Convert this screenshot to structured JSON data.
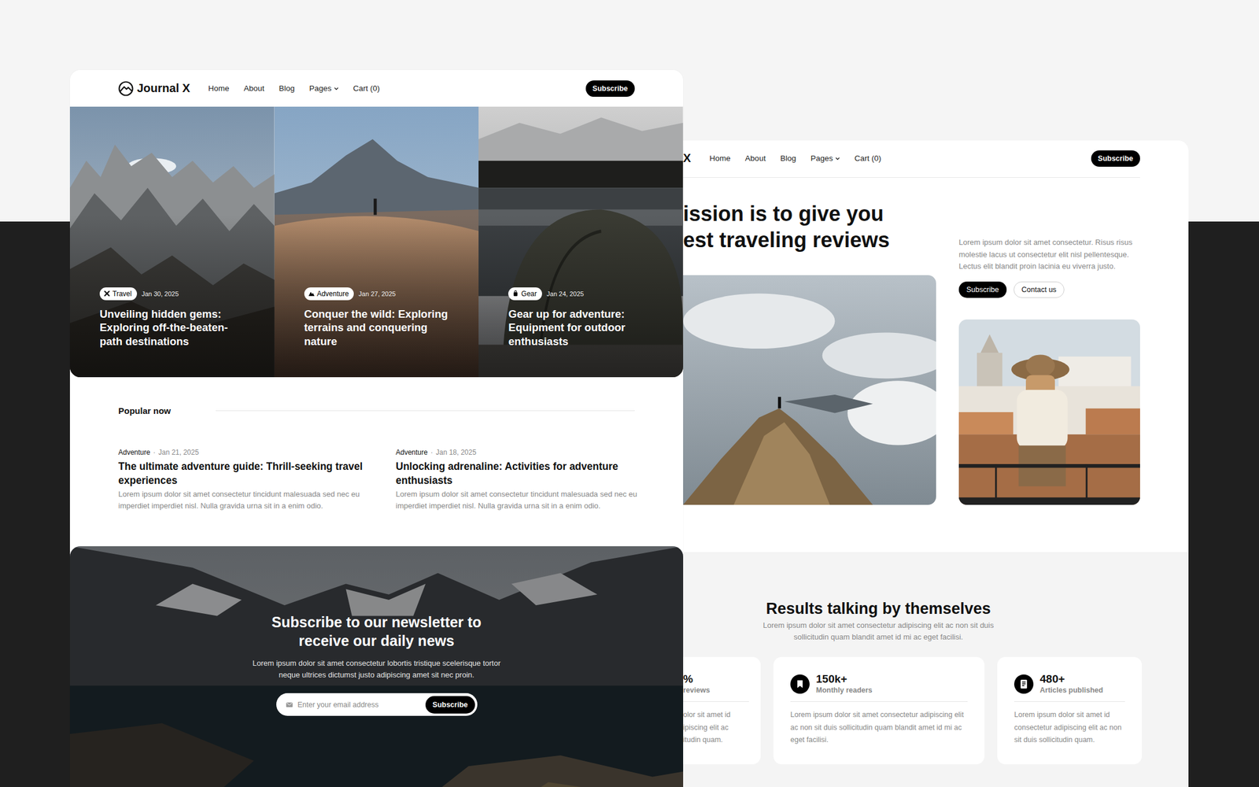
{
  "left_window": {
    "logo": "Journal X",
    "nav": [
      {
        "label": "Home",
        "has_dropdown": false
      },
      {
        "label": "About",
        "has_dropdown": false
      },
      {
        "label": "Blog",
        "has_dropdown": false
      },
      {
        "label": "Pages",
        "has_dropdown": true
      },
      {
        "label": "Cart (0)",
        "has_dropdown": false
      }
    ],
    "nav_button": "Subscribe",
    "hero_posts": [
      {
        "kind": "travel",
        "tag": "Travel",
        "date": "Jan 30, 2025",
        "title": "Unveiling hidden gems: Exploring off-the-beaten-path destinations"
      },
      {
        "kind": "adventure",
        "tag": "Adventure",
        "date": "Jan 27, 2025",
        "title": "Conquer the wild: Exploring terrains and conquering nature"
      },
      {
        "kind": "gear",
        "tag": "Gear",
        "date": "Jan 24, 2025",
        "title": "Gear up for adventure: Equipment for outdoor enthusiasts"
      }
    ],
    "popular": {
      "heading": "Popular now",
      "posts": [
        {
          "category": "Adventure",
          "separator": "·",
          "date": "Jan 21, 2025",
          "title": "The ultimate adventure guide: Thrill-seeking travel experiences",
          "excerpt": "Lorem ipsum dolor sit amet consectetur tincidunt malesuada sed nec eu imperdiet imperdiet nisl. Nulla gravida urna sit in a enim odio."
        },
        {
          "category": "Adventure",
          "separator": "·",
          "date": "Jan 18, 2025",
          "title": "Unlocking adrenaline: Activities for adventure enthusiasts",
          "excerpt": "Lorem ipsum dolor sit amet consectetur tincidunt malesuada sed nec eu imperdiet imperdiet nisl. Nulla gravida urna sit in a enim odio."
        }
      ]
    },
    "newsletter": {
      "heading": "Subscribe to our newsletter to receive our daily news",
      "text": "Lorem ipsum dolor sit amet consectetur lobortis tristique scelerisque tortor neque ultrices dictumst justo adipiscing amet sit nec proin.",
      "placeholder": "Enter your email address",
      "button": "Subscribe"
    }
  },
  "right_window": {
    "logo": "X",
    "nav": [
      {
        "label": "Home",
        "has_dropdown": false
      },
      {
        "label": "About",
        "has_dropdown": false
      },
      {
        "label": "Blog",
        "has_dropdown": false
      },
      {
        "label": "Pages",
        "has_dropdown": true
      },
      {
        "label": "Cart (0)",
        "has_dropdown": false
      }
    ],
    "nav_button": "Subscribe",
    "heading_lines": [
      "ission is to give you",
      "est traveling reviews"
    ],
    "intro": "Lorem ipsum dolor sit amet consectetur. Risus risus molestie lacus ut consectetur elit nisl pellentesque. Lectus elit blandit proin lacinia eu viverra justo.",
    "buttons": [
      {
        "label": "Subscribe",
        "kind": "dark"
      },
      {
        "label": "Contact us",
        "kind": "light"
      }
    ],
    "stats": {
      "heading": "Results talking by themselves",
      "text": "Lorem ipsum dolor sit amet consectetur adipiscing elit ac non sit duis sollicitudin quam blandit amet id mi ac eget facilisi.",
      "cards": [
        {
          "kind": "cut",
          "value": "%",
          "label": "reviews",
          "lines": [
            "olor sit amet id",
            "ipiscing elit ac",
            "itudin quam."
          ]
        },
        {
          "kind": "bookmark",
          "value": "150k+",
          "label": "Monthly readers",
          "lines": [
            "Lorem ipsum dolor sit amet consectetur adipiscing elit ac non sit duis sollicitudin quam blandit amet id mi ac eget facilisi."
          ]
        },
        {
          "kind": "document",
          "value": "480+",
          "label": "Articles published",
          "lines": [
            "Lorem ipsum dolor sit amet id consectetur adipiscing elit ac non sit duis sollicitudin quam."
          ]
        }
      ]
    }
  }
}
